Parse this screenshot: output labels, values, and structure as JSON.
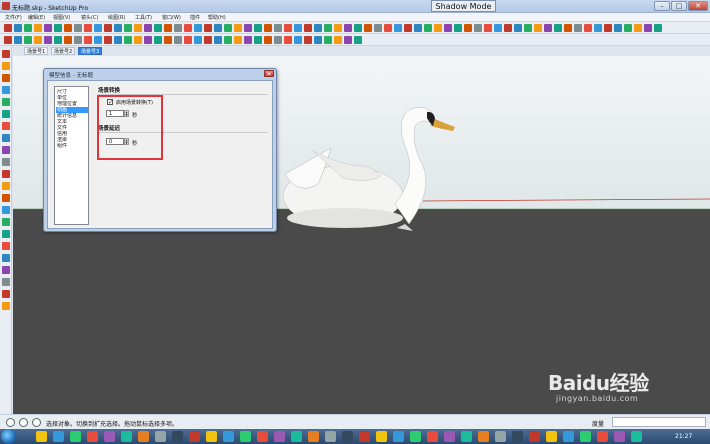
{
  "window": {
    "title": "无标题.skp - SketchUp Pro",
    "shadow_mode": "Shadow Mode",
    "controls": [
      "minimize",
      "maximize",
      "close"
    ]
  },
  "menu": [
    "文件(F)",
    "编辑(E)",
    "视图(V)",
    "镜头(C)",
    "绘图(R)",
    "工具(T)",
    "窗口(W)",
    "插件",
    "帮助(H)"
  ],
  "scene_tabs": [
    {
      "label": "场景号1",
      "active": false
    },
    {
      "label": "场景号2",
      "active": false
    },
    {
      "label": "场景号3",
      "active": true
    }
  ],
  "dialog": {
    "title": "模型信息 - 无标题",
    "categories": [
      "尺寸",
      "单位",
      "地理位置",
      "动画",
      "统计信息",
      "文本",
      "文件",
      "信用",
      "渲染",
      "组件"
    ],
    "selected_category": "动画",
    "transition_section": "场景转换",
    "enable_transition_label": "启用场景转换(T)",
    "enable_transition_checked": true,
    "transition_value": "1",
    "delay_section": "场景延迟",
    "delay_value": "0",
    "unit": "秒"
  },
  "status": {
    "text": "选择对象。切换到扩充选择。拖动鼠标选择多项。",
    "measure_label": "度量"
  },
  "taskbar": {
    "clock": "21:27"
  },
  "watermark": {
    "logo": "Baidu经验",
    "site": "jingyan.baidu.com"
  },
  "colors": {
    "sky": "#eef2f4",
    "ground": "#4a4a4a",
    "highlight": "#e0333a",
    "selection": "#3399ff"
  }
}
